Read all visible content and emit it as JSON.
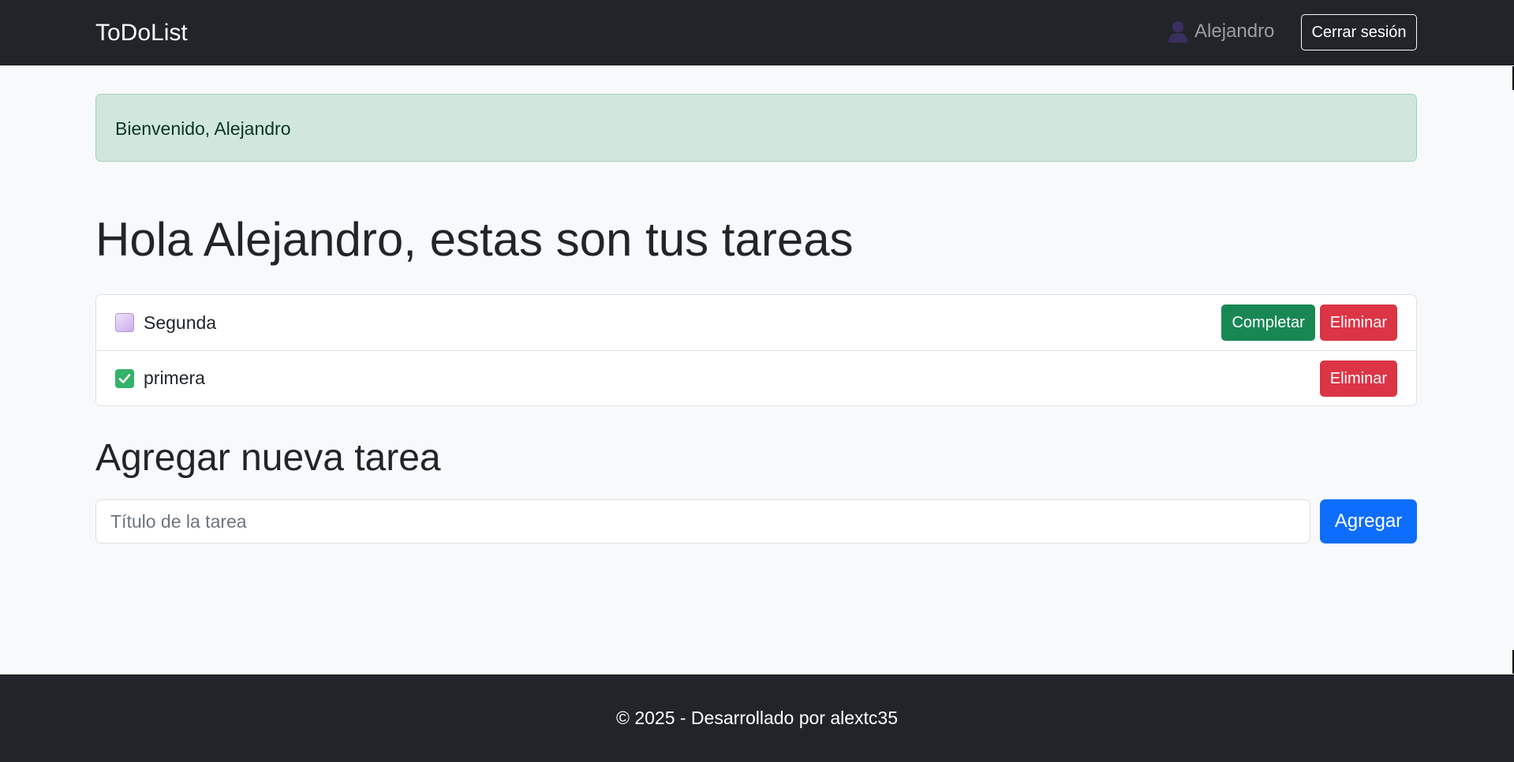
{
  "navbar": {
    "brand": "ToDoList",
    "user_name": "Alejandro",
    "user_icon": "user-icon",
    "logout_label": "Cerrar sesión"
  },
  "alert": {
    "message": "Bienvenido, Alejandro"
  },
  "main": {
    "heading": "Hola Alejandro, estas son tus tareas",
    "tasks": [
      {
        "title": "Segunda",
        "status": "pending",
        "status_icon": "unchecked-box-icon",
        "complete_label": "Completar",
        "delete_label": "Eliminar"
      },
      {
        "title": "primera",
        "status": "completed",
        "status_icon": "check-mark-icon",
        "delete_label": "Eliminar"
      }
    ]
  },
  "add_task": {
    "heading": "Agregar nueva tarea",
    "input_placeholder": "Título de la tarea",
    "input_value": "",
    "submit_label": "Agregar"
  },
  "footer": {
    "text": "© 2025 - Desarrollado por alextc35"
  },
  "colors": {
    "navbar_bg": "#212529",
    "page_bg": "#f8f9fa",
    "alert_bg": "#d1e7dd",
    "success": "#198754",
    "danger": "#dc3545",
    "primary": "#0d6efd"
  }
}
